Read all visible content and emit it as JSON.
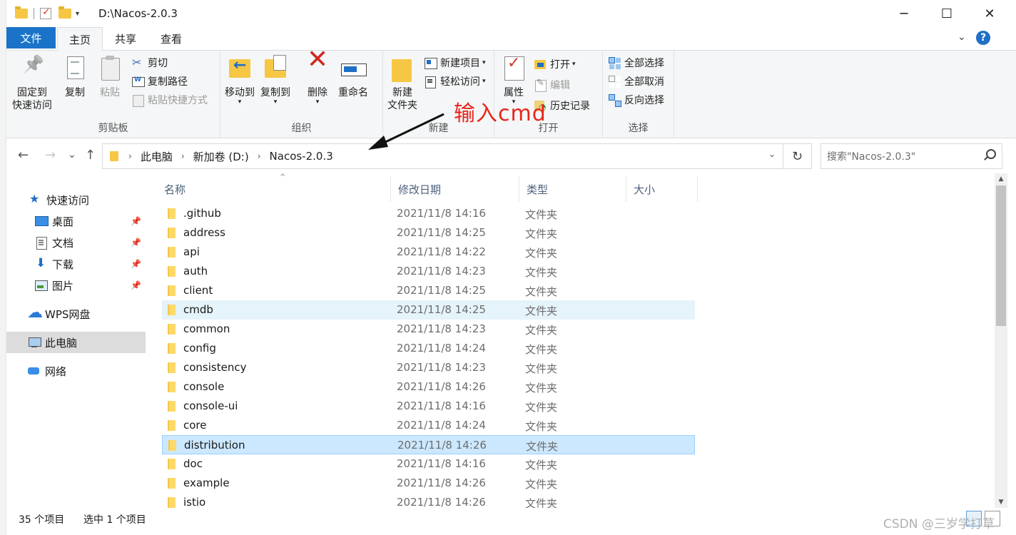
{
  "window": {
    "title": "D:\\Nacos-2.0.3",
    "controls": {
      "minimize": "─",
      "maximize": "☐",
      "close": "✕"
    }
  },
  "quick_access_toolbar": {
    "dropdown": "▾"
  },
  "tabs": {
    "file": "文件",
    "items": [
      {
        "label": "主页",
        "active": true
      },
      {
        "label": "共享",
        "active": false
      },
      {
        "label": "查看",
        "active": false
      }
    ],
    "collapse": "⌄",
    "help": "?"
  },
  "ribbon": {
    "clipboard": {
      "label": "剪贴板",
      "pin": "固定到\n快速访问",
      "pin_line1": "固定到",
      "pin_line2": "快速访问",
      "copy": "复制",
      "paste": "粘贴",
      "cut": "剪切",
      "copy_path": "复制路径",
      "paste_shortcut": "粘贴快捷方式"
    },
    "organize": {
      "label": "组织",
      "move_to": "移动到",
      "copy_to": "复制到",
      "delete": "删除",
      "rename": "重命名"
    },
    "new": {
      "label": "新建",
      "new_folder_line1": "新建",
      "new_folder_line2": "文件夹",
      "new_item": "新建项目",
      "easy_access": "轻松访问"
    },
    "open": {
      "label": "打开",
      "properties": "属性",
      "open": "打开",
      "edit": "编辑",
      "history": "历史记录"
    },
    "select": {
      "label": "选择",
      "select_all": "全部选择",
      "select_none": "全部取消",
      "invert": "反向选择"
    }
  },
  "annotation": {
    "text": "输入cmd",
    "color": "#e8251c"
  },
  "address_bar": {
    "back": "←",
    "forward": "→",
    "recent": "⌄",
    "up": "↑",
    "crumbs": [
      "此电脑",
      "新加卷 (D:)",
      "Nacos-2.0.3"
    ],
    "separator": "›",
    "dropdown": "⌄",
    "refresh": "↻"
  },
  "search": {
    "placeholder": "搜索\"Nacos-2.0.3\""
  },
  "nav_pane": {
    "quick_access": "快速访问",
    "items": [
      {
        "label": "桌面",
        "pinned": true
      },
      {
        "label": "文档",
        "pinned": true
      },
      {
        "label": "下载",
        "pinned": true
      },
      {
        "label": "图片",
        "pinned": true
      }
    ],
    "wps": "WPS网盘",
    "this_pc": "此电脑",
    "network": "网络"
  },
  "columns": {
    "name": "名称",
    "date": "修改日期",
    "type": "类型",
    "size": "大小",
    "sort_indicator": "^"
  },
  "files": [
    {
      "name": ".github",
      "date": "2021/11/8 14:16",
      "type": "文件夹",
      "state": ""
    },
    {
      "name": "address",
      "date": "2021/11/8 14:25",
      "type": "文件夹",
      "state": ""
    },
    {
      "name": "api",
      "date": "2021/11/8 14:22",
      "type": "文件夹",
      "state": ""
    },
    {
      "name": "auth",
      "date": "2021/11/8 14:23",
      "type": "文件夹",
      "state": ""
    },
    {
      "name": "client",
      "date": "2021/11/8 14:25",
      "type": "文件夹",
      "state": ""
    },
    {
      "name": "cmdb",
      "date": "2021/11/8 14:25",
      "type": "文件夹",
      "state": "hover"
    },
    {
      "name": "common",
      "date": "2021/11/8 14:23",
      "type": "文件夹",
      "state": ""
    },
    {
      "name": "config",
      "date": "2021/11/8 14:24",
      "type": "文件夹",
      "state": ""
    },
    {
      "name": "consistency",
      "date": "2021/11/8 14:23",
      "type": "文件夹",
      "state": ""
    },
    {
      "name": "console",
      "date": "2021/11/8 14:26",
      "type": "文件夹",
      "state": ""
    },
    {
      "name": "console-ui",
      "date": "2021/11/8 14:16",
      "type": "文件夹",
      "state": ""
    },
    {
      "name": "core",
      "date": "2021/11/8 14:24",
      "type": "文件夹",
      "state": ""
    },
    {
      "name": "distribution",
      "date": "2021/11/8 14:26",
      "type": "文件夹",
      "state": "selected"
    },
    {
      "name": "doc",
      "date": "2021/11/8 14:16",
      "type": "文件夹",
      "state": ""
    },
    {
      "name": "example",
      "date": "2021/11/8 14:26",
      "type": "文件夹",
      "state": ""
    },
    {
      "name": "istio",
      "date": "2021/11/8 14:26",
      "type": "文件夹",
      "state": ""
    }
  ],
  "status_bar": {
    "count": "35 个项目",
    "selected": "选中 1 个项目"
  },
  "watermark": "CSDN @三岁学打草",
  "colors": {
    "file_tab": "#1a73c9",
    "folder": "#f6c744",
    "selection": "#cce8ff",
    "hover": "#e5f3fb"
  }
}
